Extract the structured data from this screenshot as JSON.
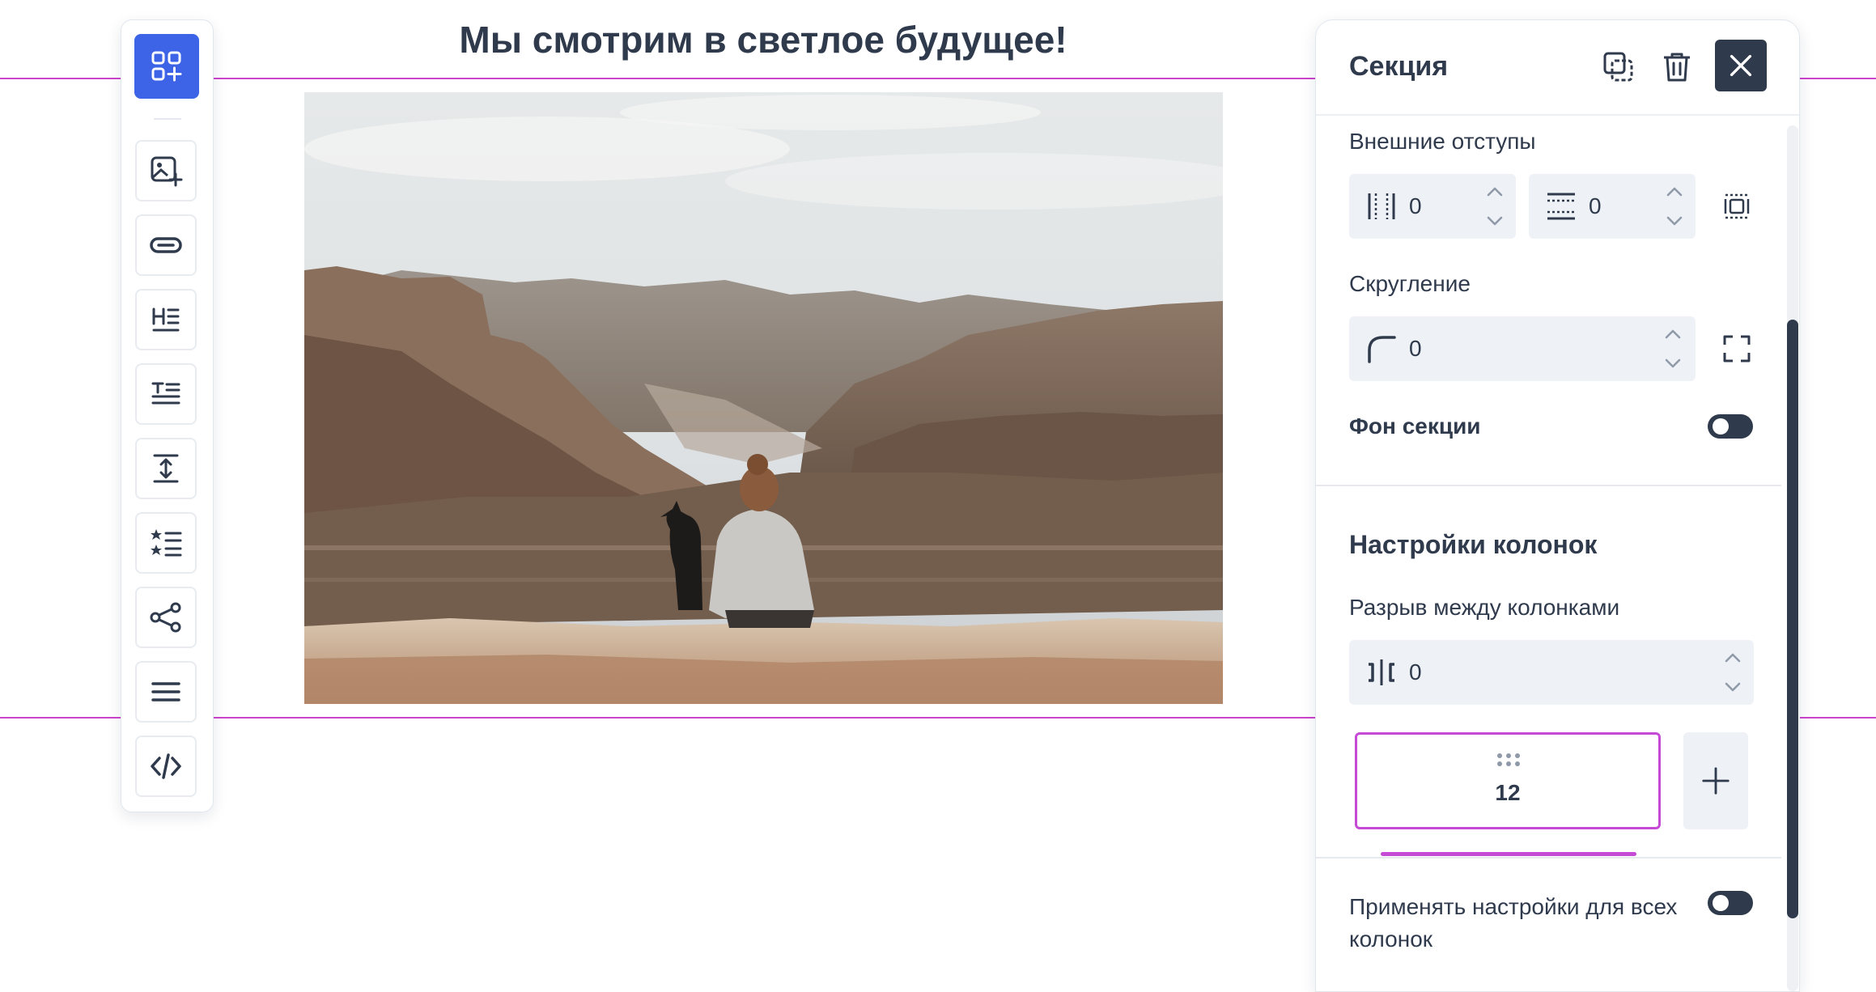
{
  "page": {
    "heading": "Мы смотрим в светлое будущее!",
    "accent_color": "#3d63e6",
    "guide_color": "#cc44cc"
  },
  "toolbar": {
    "items": [
      {
        "name": "add-block",
        "icon": "grid-plus-icon"
      },
      {
        "name": "image",
        "icon": "image-plus-icon"
      },
      {
        "name": "button",
        "icon": "pill-button-icon"
      },
      {
        "name": "heading",
        "icon": "heading-icon"
      },
      {
        "name": "text",
        "icon": "text-icon"
      },
      {
        "name": "spacer",
        "icon": "vertical-spacer-icon"
      },
      {
        "name": "list",
        "icon": "list-stars-icon"
      },
      {
        "name": "social",
        "icon": "share-icon"
      },
      {
        "name": "menu",
        "icon": "menu-icon"
      },
      {
        "name": "html",
        "icon": "code-icon"
      }
    ]
  },
  "panel": {
    "title": "Секция",
    "margins": {
      "label": "Внешние отступы",
      "horizontal_value": "0",
      "vertical_value": "0"
    },
    "radius": {
      "label": "Скругление",
      "value": "0"
    },
    "background": {
      "label": "Фон секции",
      "enabled": false
    },
    "columns": {
      "title": "Настройки колонок",
      "gap_label": "Разрыв между колонками",
      "gap_value": "0",
      "column_list": [
        {
          "span": "12"
        }
      ],
      "apply_all_label": "Применять настройки для всех колонок",
      "apply_all_enabled": false
    }
  }
}
